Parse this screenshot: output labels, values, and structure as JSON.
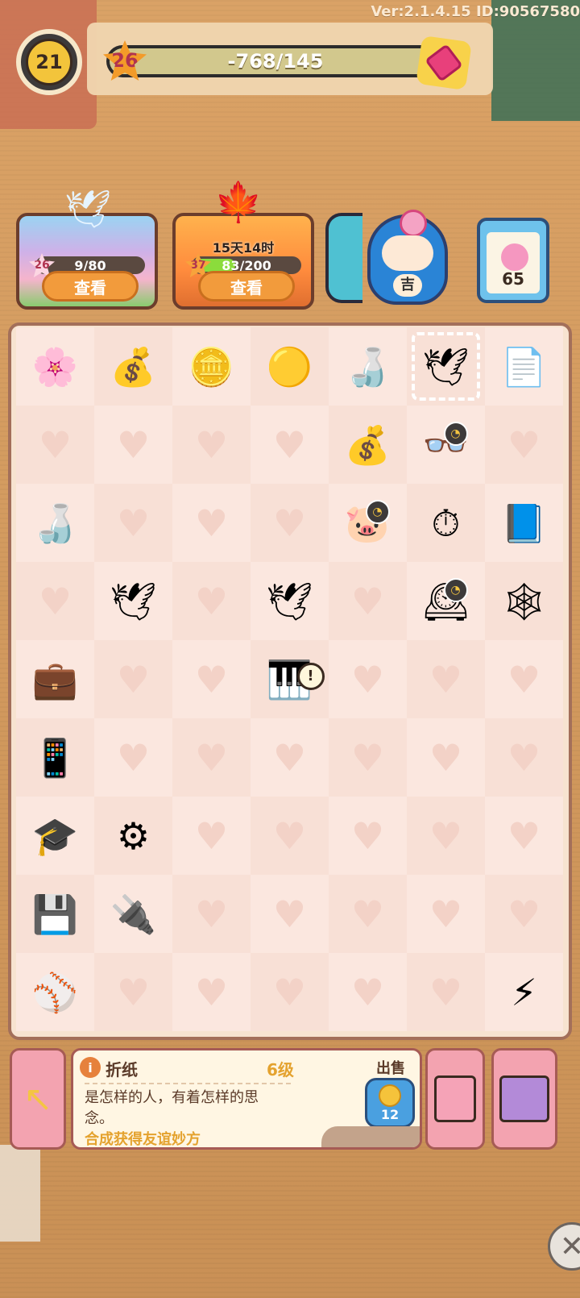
{
  "version_label": "Ver:2.1.4.15 ID:90567580",
  "player": {
    "level": "21"
  },
  "experience": {
    "level": "26",
    "progress_text": "-768/145"
  },
  "events": [
    {
      "level": "26",
      "progress": "9/80",
      "fill": 0.11,
      "view_label": "查看",
      "icon": "paper-crane-icon"
    },
    {
      "level": "37",
      "timer": "15天14时",
      "progress": "83/200",
      "fill": 0.42,
      "view_label": "查看",
      "icon": "maple-leaf-icon"
    }
  ],
  "right_widgets": {
    "daruma_badge": "吉",
    "task_board_count": "65"
  },
  "board": {
    "rows": [
      [
        {
          "icon": "cherry-blossom-icon",
          "g": "🌸"
        },
        {
          "icon": "coin-pile-icon",
          "g": "💰"
        },
        {
          "icon": "coin-stack-icon",
          "g": "🪙"
        },
        {
          "icon": "coin-icon",
          "g": "🟡"
        },
        {
          "icon": "crane-bottle-icon",
          "g": "🍶"
        },
        {
          "icon": "paper-crane-icon",
          "g": "🕊",
          "selected": true
        },
        {
          "icon": "paper-stack-icon",
          "g": "📄"
        }
      ],
      [
        {
          "heart": true
        },
        {
          "heart": true
        },
        {
          "heart": true
        },
        {
          "heart": true
        },
        {
          "icon": "coins-icon",
          "g": "💰"
        },
        {
          "icon": "glasses-icon",
          "g": "👓",
          "clock": true
        },
        {
          "heart": true
        }
      ],
      [
        {
          "icon": "crane-bottle-icon",
          "g": "🍶"
        },
        {
          "heart": true
        },
        {
          "heart": true
        },
        {
          "heart": true
        },
        {
          "icon": "piggy-bank-icon",
          "g": "🐷",
          "clock": true
        },
        {
          "icon": "stopwatch-icon",
          "g": "⏱"
        },
        {
          "icon": "lightning-book-icon",
          "g": "📘"
        }
      ],
      [
        {
          "heart": true
        },
        {
          "icon": "paper-crane-icon",
          "g": "🕊"
        },
        {
          "heart": true
        },
        {
          "icon": "crane-group-icon",
          "g": "🕊"
        },
        {
          "heart": true
        },
        {
          "icon": "grandfather-clock-icon",
          "g": "🕰",
          "clock": true
        },
        {
          "icon": "web-crane-icon",
          "g": "🕸"
        }
      ],
      [
        {
          "icon": "briefcase-icon",
          "g": "💼"
        },
        {
          "heart": true
        },
        {
          "heart": true
        },
        {
          "icon": "piano-music-box-icon",
          "g": "🎹",
          "alert": true
        },
        {
          "heart": true
        },
        {
          "heart": true
        },
        {
          "heart": true
        }
      ],
      [
        {
          "icon": "tablet-icon",
          "g": "📱"
        },
        {
          "heart": true
        },
        {
          "heart": true
        },
        {
          "heart": true
        },
        {
          "heart": true
        },
        {
          "heart": true
        },
        {
          "heart": true
        }
      ],
      [
        {
          "icon": "graduation-cap-icon",
          "g": "🎓"
        },
        {
          "icon": "gear-icon",
          "g": "⚙"
        },
        {
          "heart": true
        },
        {
          "heart": true
        },
        {
          "heart": true
        },
        {
          "heart": true
        },
        {
          "heart": true
        }
      ],
      [
        {
          "icon": "circuit-board-icon",
          "g": "💾"
        },
        {
          "icon": "cable-icon",
          "g": "🔌"
        },
        {
          "heart": true
        },
        {
          "heart": true
        },
        {
          "heart": true
        },
        {
          "heart": true
        },
        {
          "heart": true
        }
      ],
      [
        {
          "icon": "baseball-icon",
          "g": "⚾"
        },
        {
          "heart": true
        },
        {
          "heart": true
        },
        {
          "heart": true
        },
        {
          "heart": true
        },
        {
          "heart": true
        },
        {
          "icon": "lightning-generator-icon",
          "g": "⚡"
        }
      ]
    ]
  },
  "item_info": {
    "name": "折纸",
    "level": "6级",
    "description": "是怎样的人，有着怎样的思念。",
    "hint": "合成获得友谊妙方",
    "sell_label": "出售",
    "sell_price": "12"
  }
}
